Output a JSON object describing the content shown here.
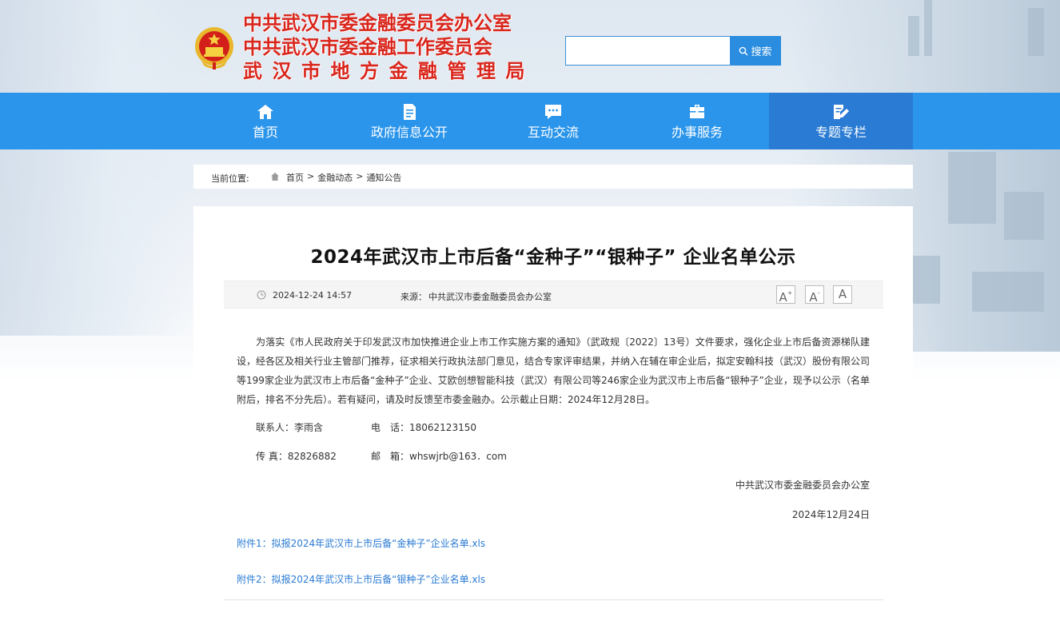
{
  "header": {
    "org_names": [
      "中共武汉市委金融委员会办公室",
      "中共武汉市委金融工作委员会",
      "武汉市地方金融管理局"
    ],
    "search_placeholder": "",
    "search_label": "搜索"
  },
  "nav": {
    "items": [
      {
        "label": "首页",
        "icon": "home-icon"
      },
      {
        "label": "政府信息公开",
        "icon": "document-icon"
      },
      {
        "label": "互动交流",
        "icon": "chat-icon"
      },
      {
        "label": "办事服务",
        "icon": "briefcase-icon"
      },
      {
        "label": "专题专栏",
        "icon": "edit-icon"
      }
    ],
    "active_index": 4
  },
  "breadcrumb": {
    "prefix": "当前位置:",
    "items": [
      "首页",
      "金融动态",
      "通知公告"
    ],
    "separator": ">"
  },
  "article": {
    "title": "2024年武汉市上市后备“金种子”“银种子” 企业名单公示",
    "date": "2024-12-24 14:57",
    "source_label": "来源：",
    "source": "中共武汉市委金融委员会办公室",
    "font_buttons": [
      "A",
      "A",
      "A"
    ],
    "body": "为落实《市人民政府关于印发武汉市加快推进企业上市工作实施方案的通知》（武政规〔2022〕13号）文件要求，强化企业上市后备资源梯队建设，经各区及相关行业主管部门推荐，征求相关行政执法部门意见，结合专家评审结果，并纳入在辅在审企业后，拟定安翰科技（武汉）股份有限公司等199家企业为武汉市上市后备“金种子”企业、艾欧创想智能科技（武汉）有限公司等246家企业为武汉市上市后备“银种子”企业，现予以公示（名单附后，排名不分先后）。若有疑问，请及时反馈至市委金融办。公示截止日期：2024年12月28日。",
    "contact_person": "联系人：李雨含",
    "phone": "电　话：18062123150",
    "fax": "传  真：82826882",
    "email": "邮　箱：whswjrb@163．com",
    "signature": "中共武汉市委金融委员会办公室",
    "sign_date": "2024年12月24日",
    "attachments": [
      "附件1：拟报2024年武汉市上市后备“金种子”企业名单.xls",
      "附件2：拟报2024年武汉市上市后备“银种子”企业名单.xls"
    ]
  },
  "colors": {
    "nav_bg": "#2a95eb",
    "nav_active": "#2a7bd3",
    "org_red": "#d9261c",
    "link": "#2a7bd3"
  }
}
